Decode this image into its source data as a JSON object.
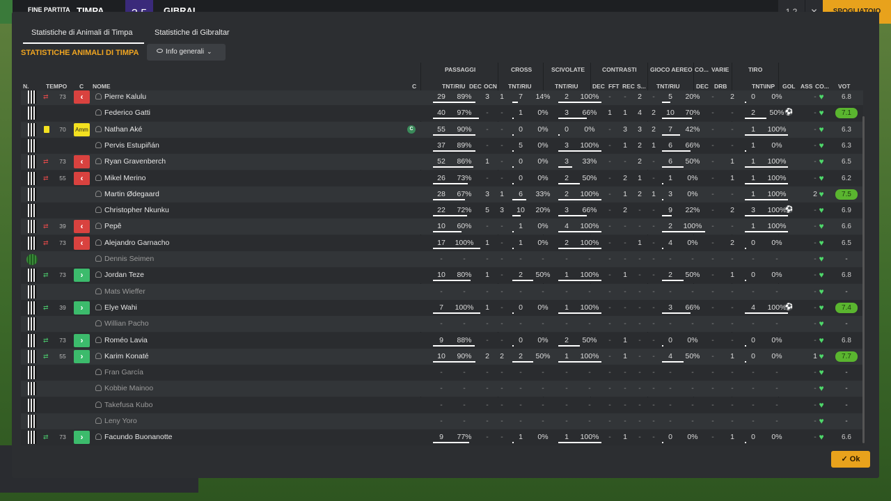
{
  "topbar": {
    "fine": "FINE PARTITA",
    "team1": "TIMPA",
    "score": "3 5",
    "team2": "GIBRAL",
    "counter": "1 2",
    "close": "✕",
    "spog": "SPOGLIATOIO"
  },
  "tabs": [
    "Statistiche di Animali di Timpa",
    "Statistiche di Gibraltar"
  ],
  "section_title": "STATISTICHE ANIMALI DI TIMPA",
  "view_button": "Info generali",
  "group_headers": {
    "passaggi": "PASSAGGI",
    "cross": "CROSS",
    "scivolate": "SCIVOLATE",
    "contrasti": "CONTRASTI",
    "gioco_aereo": "GIOCO AEREO",
    "co": "CO...",
    "varie": "VARIE",
    "tiro": "TIRO"
  },
  "col_headers": {
    "n": "N.",
    "tempo": "TEMPO",
    "c": "C",
    "nome": "NOME",
    "c2": "C",
    "pass": "TNT/RIU",
    "dec": "DEC",
    "ocn": "OCN",
    "cross": "TNT/RIU",
    "sciv": "TNT/RIU",
    "cdec": "DEC",
    "fft": "FFT",
    "rec": "REC",
    "s": "S...",
    "aereo": "TNT/RIU",
    "codec": "DEC",
    "drb": "DRB",
    "tiro": "TNT\\INP",
    "gol": "GOL",
    "ass": "ASS",
    "cond": "CO...",
    "vot": "VOT"
  },
  "players": [
    {
      "name": "Pierre Kalulu",
      "sub": "out",
      "min": "73",
      "p": [
        "29",
        "89%"
      ],
      "dec": "3",
      "ocn": "1",
      "cr": [
        "7",
        "14%"
      ],
      "sc": [
        "2",
        "100%"
      ],
      "ct": [
        "-",
        "-",
        "2",
        "-"
      ],
      "ae": [
        "5",
        "20%"
      ],
      "cd": "-",
      "drb": "2",
      "ti": [
        "0",
        "0%"
      ],
      "gol": "",
      "ass": "-",
      "vot": "6.8",
      "good": false
    },
    {
      "name": "Federico Gatti",
      "sub": "",
      "min": "",
      "p": [
        "40",
        "97%"
      ],
      "dec": "-",
      "ocn": "-",
      "cr": [
        "1",
        "0%"
      ],
      "sc": [
        "3",
        "66%"
      ],
      "ct": [
        "1",
        "1",
        "4",
        "2"
      ],
      "ae": [
        "10",
        "70%"
      ],
      "cd": "-",
      "drb": "-",
      "ti": [
        "2",
        "50%"
      ],
      "gol": "⚽",
      "ass": "-",
      "vot": "7.1",
      "good": true
    },
    {
      "name": "Nathan Aké",
      "sub": "amm",
      "min": "70",
      "p": [
        "55",
        "90%"
      ],
      "dec": "-",
      "ocn": "-",
      "cr": [
        "0",
        "0%"
      ],
      "sc": [
        "0",
        "0%"
      ],
      "ct": [
        "-",
        "3",
        "3",
        "2"
      ],
      "ae": [
        "7",
        "42%"
      ],
      "cd": "-",
      "drb": "-",
      "ti": [
        "1",
        "100%"
      ],
      "gol": "",
      "ass": "-",
      "vot": "6.3",
      "good": false,
      "cap": "C"
    },
    {
      "name": "Pervis Estupiñán",
      "sub": "",
      "min": "",
      "p": [
        "37",
        "89%"
      ],
      "dec": "-",
      "ocn": "-",
      "cr": [
        "5",
        "0%"
      ],
      "sc": [
        "3",
        "100%"
      ],
      "ct": [
        "-",
        "1",
        "2",
        "1"
      ],
      "ae": [
        "6",
        "66%"
      ],
      "cd": "-",
      "drb": "-",
      "ti": [
        "1",
        "0%"
      ],
      "gol": "",
      "ass": "-",
      "vot": "6.3",
      "good": false
    },
    {
      "name": "Ryan Gravenberch",
      "sub": "out",
      "min": "73",
      "p": [
        "52",
        "86%"
      ],
      "dec": "1",
      "ocn": "-",
      "cr": [
        "0",
        "0%"
      ],
      "sc": [
        "3",
        "33%"
      ],
      "ct": [
        "-",
        "-",
        "2",
        "-"
      ],
      "ae": [
        "6",
        "50%"
      ],
      "cd": "-",
      "drb": "1",
      "ti": [
        "1",
        "100%"
      ],
      "gol": "",
      "ass": "-",
      "vot": "6.5",
      "good": false
    },
    {
      "name": "Mikel Merino",
      "sub": "out",
      "min": "55",
      "p": [
        "26",
        "73%"
      ],
      "dec": "-",
      "ocn": "-",
      "cr": [
        "0",
        "0%"
      ],
      "sc": [
        "2",
        "50%"
      ],
      "ct": [
        "-",
        "2",
        "1",
        "-"
      ],
      "ae": [
        "1",
        "0%"
      ],
      "cd": "-",
      "drb": "1",
      "ti": [
        "1",
        "100%"
      ],
      "gol": "",
      "ass": "-",
      "vot": "6.2",
      "good": false
    },
    {
      "name": "Martin Ødegaard",
      "sub": "",
      "min": "",
      "p": [
        "28",
        "67%"
      ],
      "dec": "3",
      "ocn": "1",
      "cr": [
        "6",
        "33%"
      ],
      "sc": [
        "2",
        "100%"
      ],
      "ct": [
        "-",
        "1",
        "2",
        "1"
      ],
      "ae": [
        "3",
        "0%"
      ],
      "cd": "-",
      "drb": "-",
      "ti": [
        "1",
        "100%"
      ],
      "gol": "",
      "ass": "2",
      "vot": "7.5",
      "good": true
    },
    {
      "name": "Christopher Nkunku",
      "sub": "",
      "min": "",
      "p": [
        "22",
        "72%"
      ],
      "dec": "5",
      "ocn": "3",
      "cr": [
        "10",
        "20%"
      ],
      "sc": [
        "3",
        "66%"
      ],
      "ct": [
        "-",
        "2",
        "-",
        "-"
      ],
      "ae": [
        "9",
        "22%"
      ],
      "cd": "-",
      "drb": "2",
      "ti": [
        "3",
        "100%"
      ],
      "gol": "⚽",
      "ass": "-",
      "vot": "6.9",
      "good": false
    },
    {
      "name": "Pepê",
      "sub": "out",
      "min": "39",
      "p": [
        "10",
        "60%"
      ],
      "dec": "-",
      "ocn": "-",
      "cr": [
        "1",
        "0%"
      ],
      "sc": [
        "4",
        "100%"
      ],
      "ct": [
        "-",
        "-",
        "-",
        "-"
      ],
      "ae": [
        "2",
        "100%"
      ],
      "cd": "-",
      "drb": "-",
      "ti": [
        "1",
        "100%"
      ],
      "gol": "",
      "ass": "-",
      "vot": "6.6",
      "good": false
    },
    {
      "name": "Alejandro Garnacho",
      "sub": "out",
      "min": "73",
      "p": [
        "17",
        "100%"
      ],
      "dec": "1",
      "ocn": "-",
      "cr": [
        "1",
        "0%"
      ],
      "sc": [
        "2",
        "100%"
      ],
      "ct": [
        "-",
        "-",
        "1",
        "-"
      ],
      "ae": [
        "4",
        "0%"
      ],
      "cd": "-",
      "drb": "2",
      "ti": [
        "0",
        "0%"
      ],
      "gol": "",
      "ass": "-",
      "vot": "6.5",
      "good": false
    },
    {
      "name": "Dennis Seimen",
      "sub": "",
      "min": "",
      "gk": true,
      "p": [
        "-",
        "-"
      ],
      "dec": "-",
      "ocn": "-",
      "cr": [
        "-",
        "-"
      ],
      "sc": [
        "-",
        "-"
      ],
      "ct": [
        "-",
        "-",
        "-",
        "-"
      ],
      "ae": [
        "-",
        "-"
      ],
      "cd": "-",
      "drb": "-",
      "ti": [
        "-",
        "-"
      ],
      "gol": "",
      "ass": "-",
      "vot": "-",
      "good": false,
      "unused": true
    },
    {
      "name": "Jordan Teze",
      "sub": "in",
      "min": "73",
      "p": [
        "10",
        "80%"
      ],
      "dec": "1",
      "ocn": "-",
      "cr": [
        "2",
        "50%"
      ],
      "sc": [
        "1",
        "100%"
      ],
      "ct": [
        "-",
        "1",
        "-",
        "-"
      ],
      "ae": [
        "2",
        "50%"
      ],
      "cd": "-",
      "drb": "1",
      "ti": [
        "0",
        "0%"
      ],
      "gol": "",
      "ass": "-",
      "vot": "6.8",
      "good": false
    },
    {
      "name": "Mats Wieffer",
      "sub": "",
      "min": "",
      "p": [
        "-",
        "-"
      ],
      "dec": "-",
      "ocn": "-",
      "cr": [
        "-",
        "-"
      ],
      "sc": [
        "-",
        "-"
      ],
      "ct": [
        "-",
        "-",
        "-",
        "-"
      ],
      "ae": [
        "-",
        "-"
      ],
      "cd": "-",
      "drb": "-",
      "ti": [
        "-",
        "-"
      ],
      "gol": "",
      "ass": "-",
      "vot": "-",
      "good": false,
      "unused": true
    },
    {
      "name": "Elye Wahi",
      "sub": "in",
      "min": "39",
      "p": [
        "7",
        "100%"
      ],
      "dec": "1",
      "ocn": "-",
      "cr": [
        "0",
        "0%"
      ],
      "sc": [
        "1",
        "100%"
      ],
      "ct": [
        "-",
        "-",
        "-",
        "-"
      ],
      "ae": [
        "3",
        "66%"
      ],
      "cd": "-",
      "drb": "-",
      "ti": [
        "4",
        "100%"
      ],
      "gol": "⚽",
      "ass": "-",
      "vot": "7.4",
      "good": true
    },
    {
      "name": "Willian Pacho",
      "sub": "",
      "min": "",
      "p": [
        "-",
        "-"
      ],
      "dec": "-",
      "ocn": "-",
      "cr": [
        "-",
        "-"
      ],
      "sc": [
        "-",
        "-"
      ],
      "ct": [
        "-",
        "-",
        "-",
        "-"
      ],
      "ae": [
        "-",
        "-"
      ],
      "cd": "-",
      "drb": "-",
      "ti": [
        "-",
        "-"
      ],
      "gol": "",
      "ass": "-",
      "vot": "-",
      "good": false,
      "unused": true
    },
    {
      "name": "Roméo Lavia",
      "sub": "in",
      "min": "73",
      "p": [
        "9",
        "88%"
      ],
      "dec": "-",
      "ocn": "-",
      "cr": [
        "0",
        "0%"
      ],
      "sc": [
        "2",
        "50%"
      ],
      "ct": [
        "-",
        "1",
        "-",
        "-"
      ],
      "ae": [
        "0",
        "0%"
      ],
      "cd": "-",
      "drb": "-",
      "ti": [
        "0",
        "0%"
      ],
      "gol": "",
      "ass": "-",
      "vot": "6.8",
      "good": false
    },
    {
      "name": "Karim Konaté",
      "sub": "in",
      "min": "55",
      "p": [
        "10",
        "90%"
      ],
      "dec": "2",
      "ocn": "2",
      "cr": [
        "2",
        "50%"
      ],
      "sc": [
        "1",
        "100%"
      ],
      "ct": [
        "-",
        "1",
        "-",
        "-"
      ],
      "ae": [
        "4",
        "50%"
      ],
      "cd": "-",
      "drb": "1",
      "ti": [
        "0",
        "0%"
      ],
      "gol": "",
      "ass": "1",
      "vot": "7.7",
      "good": true
    },
    {
      "name": "Fran García",
      "sub": "",
      "min": "",
      "p": [
        "-",
        "-"
      ],
      "dec": "-",
      "ocn": "-",
      "cr": [
        "-",
        "-"
      ],
      "sc": [
        "-",
        "-"
      ],
      "ct": [
        "-",
        "-",
        "-",
        "-"
      ],
      "ae": [
        "-",
        "-"
      ],
      "cd": "-",
      "drb": "-",
      "ti": [
        "-",
        "-"
      ],
      "gol": "",
      "ass": "-",
      "vot": "-",
      "good": false,
      "unused": true
    },
    {
      "name": "Kobbie Mainoo",
      "sub": "",
      "min": "",
      "p": [
        "-",
        "-"
      ],
      "dec": "-",
      "ocn": "-",
      "cr": [
        "-",
        "-"
      ],
      "sc": [
        "-",
        "-"
      ],
      "ct": [
        "-",
        "-",
        "-",
        "-"
      ],
      "ae": [
        "-",
        "-"
      ],
      "cd": "-",
      "drb": "-",
      "ti": [
        "-",
        "-"
      ],
      "gol": "",
      "ass": "-",
      "vot": "-",
      "good": false,
      "unused": true
    },
    {
      "name": "Takefusa Kubo",
      "sub": "",
      "min": "",
      "p": [
        "-",
        "-"
      ],
      "dec": "-",
      "ocn": "-",
      "cr": [
        "-",
        "-"
      ],
      "sc": [
        "-",
        "-"
      ],
      "ct": [
        "-",
        "-",
        "-",
        "-"
      ],
      "ae": [
        "-",
        "-"
      ],
      "cd": "-",
      "drb": "-",
      "ti": [
        "-",
        "-"
      ],
      "gol": "",
      "ass": "-",
      "vot": "-",
      "good": false,
      "unused": true
    },
    {
      "name": "Leny Yoro",
      "sub": "",
      "min": "",
      "p": [
        "-",
        "-"
      ],
      "dec": "-",
      "ocn": "-",
      "cr": [
        "-",
        "-"
      ],
      "sc": [
        "-",
        "-"
      ],
      "ct": [
        "-",
        "-",
        "-",
        "-"
      ],
      "ae": [
        "-",
        "-"
      ],
      "cd": "-",
      "drb": "-",
      "ti": [
        "-",
        "-"
      ],
      "gol": "",
      "ass": "-",
      "vot": "-",
      "good": false,
      "unused": true
    },
    {
      "name": "Facundo Buonanotte",
      "sub": "in",
      "min": "73",
      "p": [
        "9",
        "77%"
      ],
      "dec": "-",
      "ocn": "-",
      "cr": [
        "1",
        "0%"
      ],
      "sc": [
        "1",
        "100%"
      ],
      "ct": [
        "-",
        "1",
        "-",
        "-"
      ],
      "ae": [
        "0",
        "0%"
      ],
      "cd": "-",
      "drb": "1",
      "ti": [
        "0",
        "0%"
      ],
      "gol": "",
      "ass": "-",
      "vot": "6.6",
      "good": false
    }
  ],
  "amm_label": "Amm",
  "ok_label": "Ok",
  "colors": {
    "accent": "#f0a521",
    "sub_out": "#d9423f",
    "sub_in": "#3cbb6c",
    "rating_good": "#5ab52f"
  }
}
